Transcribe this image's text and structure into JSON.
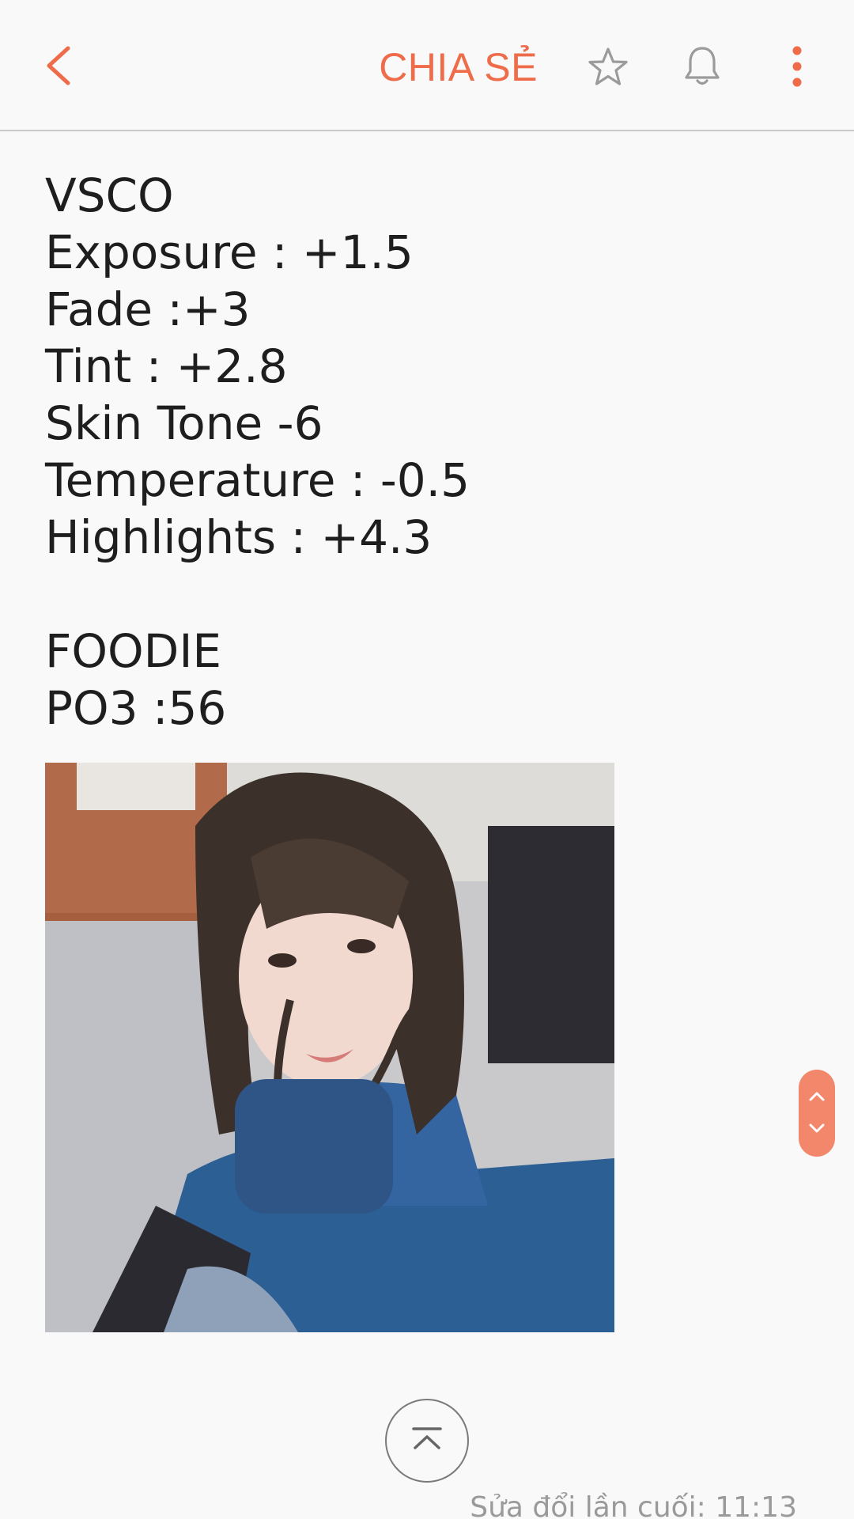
{
  "header": {
    "share_label": "CHIA SẺ",
    "back_icon": "chevron-left-icon",
    "star_icon": "star-outline-icon",
    "bell_icon": "bell-icon",
    "more_icon": "more-vertical-icon",
    "accent_color": "#ef6c4a"
  },
  "note": {
    "lines": [
      "VSCO",
      "Exposure : +1.5",
      "Fade :+3",
      "Tint : +2.8",
      "Skin Tone -6",
      "Temperature : -0.5",
      "Highlights : +4.3",
      "",
      "FOODIE",
      "PO3 :56"
    ]
  },
  "footer": {
    "last_modified": "Sửa đổi lần cuối: 11:13",
    "scroll_top_icon": "scroll-to-top-icon",
    "scroll_handle_icons": [
      "chevron-up-icon",
      "chevron-down-icon"
    ]
  }
}
